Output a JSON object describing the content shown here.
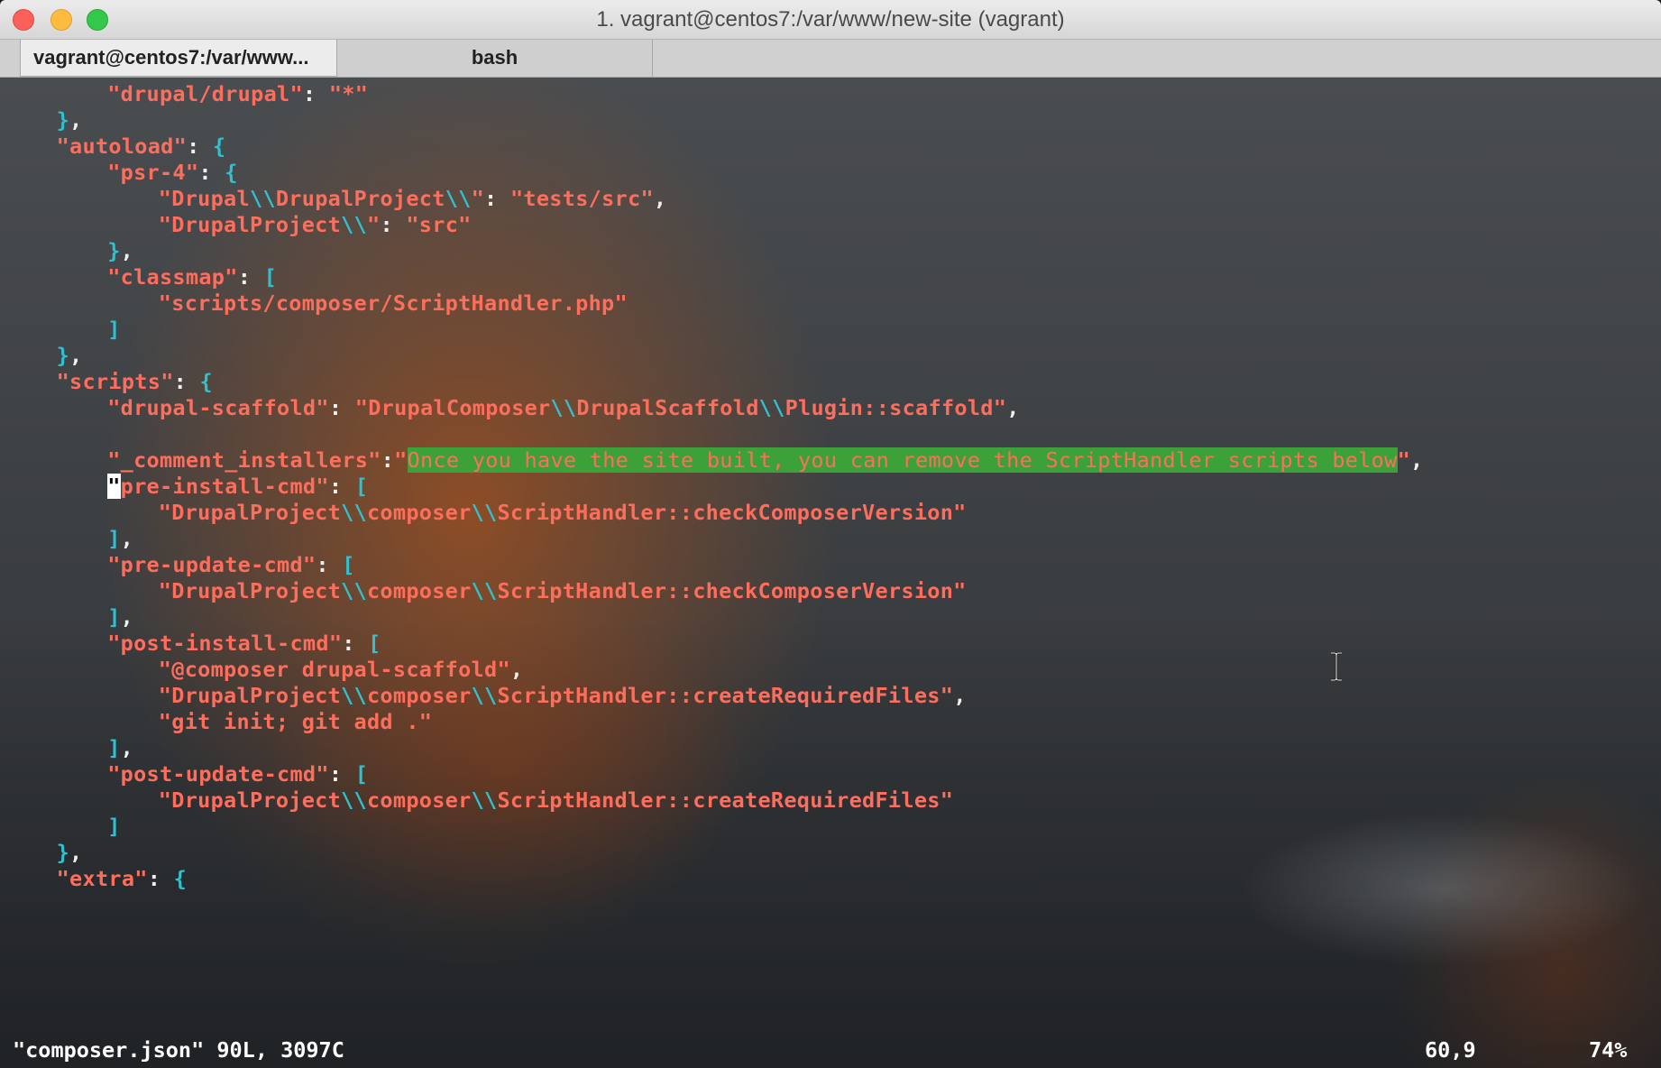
{
  "window": {
    "title": "1. vagrant@centos7:/var/www/new-site (vagrant)"
  },
  "tabs": [
    {
      "label": "vagrant@centos7:/var/www..."
    },
    {
      "label": "bash"
    }
  ],
  "editor": {
    "lines": [
      "\"drupal/drupal\": \"*\"",
      "},",
      "\"autoload\": {",
      "\"psr-4\": {",
      "\"Drupal\\\\DrupalProject\\\\\": \"tests/src\",",
      "\"DrupalProject\\\\\": \"src\"",
      "},",
      "\"classmap\": [",
      "\"scripts/composer/ScriptHandler.php\"",
      "]",
      "},",
      "\"scripts\": {",
      "\"drupal-scaffold\": \"DrupalComposer\\\\DrupalScaffold\\\\Plugin::scaffold\",",
      "",
      "\"_comment_installers\":\"Once you have the site built, you can remove the ScriptHandler scripts below\",",
      "\"pre-install-cmd\": [",
      "\"DrupalProject\\\\composer\\\\ScriptHandler::checkComposerVersion\"",
      "],",
      "\"pre-update-cmd\": [",
      "\"DrupalProject\\\\composer\\\\ScriptHandler::checkComposerVersion\"",
      "],",
      "\"post-install-cmd\": [",
      "\"@composer drupal-scaffold\",",
      "\"DrupalProject\\\\composer\\\\ScriptHandler::createRequiredFiles\",",
      "\"git init; git add .\"",
      "],",
      "\"post-update-cmd\": [",
      "\"DrupalProject\\\\composer\\\\ScriptHandler::createRequiredFiles\"",
      "]",
      "},",
      "\"extra\": {"
    ],
    "highlighted_text": "Once you have the site built, you can remove the ScriptHandler scripts below"
  },
  "statusbar": {
    "file_info": "\"composer.json\" 90L, 3097C",
    "cursor_position": "60,9",
    "scroll_percent": "74%"
  },
  "colors": {
    "key": "#ff6d5c",
    "bracket": "#2fc1cf",
    "highlight_bg": "#3da13a",
    "punct": "#f0f0f0"
  }
}
